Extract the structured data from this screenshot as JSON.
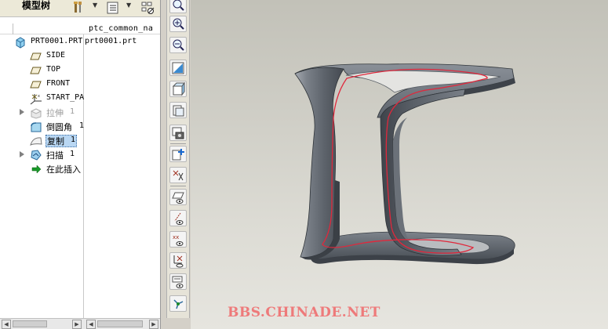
{
  "model_tree": {
    "title": "模型树",
    "column_header": "ptc_common_na",
    "rows": [
      {
        "label": "PRT0001.PRT",
        "column_value": "prt0001.prt",
        "icon": "part-icon"
      },
      {
        "label": "SIDE",
        "icon": "datum-plane-icon"
      },
      {
        "label": "TOP",
        "icon": "datum-plane-icon"
      },
      {
        "label": "FRONT",
        "icon": "datum-plane-icon"
      },
      {
        "label": "START_PA",
        "icon": "csys-icon"
      },
      {
        "label": "拉伸",
        "number": "1",
        "icon": "extrude-icon",
        "expandable": true,
        "suppressed": true
      },
      {
        "label": "倒圆角",
        "number": "1",
        "icon": "round-icon"
      },
      {
        "label": "复制",
        "number": "1",
        "icon": "copy-surface-icon",
        "selected": true
      },
      {
        "label": "扫描",
        "number": "1",
        "icon": "sweep-icon",
        "expandable": true
      },
      {
        "label": "在此插入",
        "icon": "insert-here-arrow-icon"
      }
    ]
  },
  "vertical_toolbar": {
    "buttons": [
      "zoom-fit-icon",
      "zoom-in-icon",
      "zoom-out-icon",
      "repaint-icon",
      "orient-icon",
      "saved-views-icon",
      "layer-icon",
      "datum-point-display-icon",
      "csys-display-icon",
      "datum-plane-display-icon",
      "axis-display-icon",
      "point-display-icon",
      "csys-toggle-icon",
      "annotation-icon",
      "spin-center-icon"
    ]
  },
  "viewport": {
    "watermark": "BBS.CHINADE.NET",
    "model_color": "#5f6670",
    "curve_color": "#e0283c",
    "background_color": "#d6d5ce"
  }
}
